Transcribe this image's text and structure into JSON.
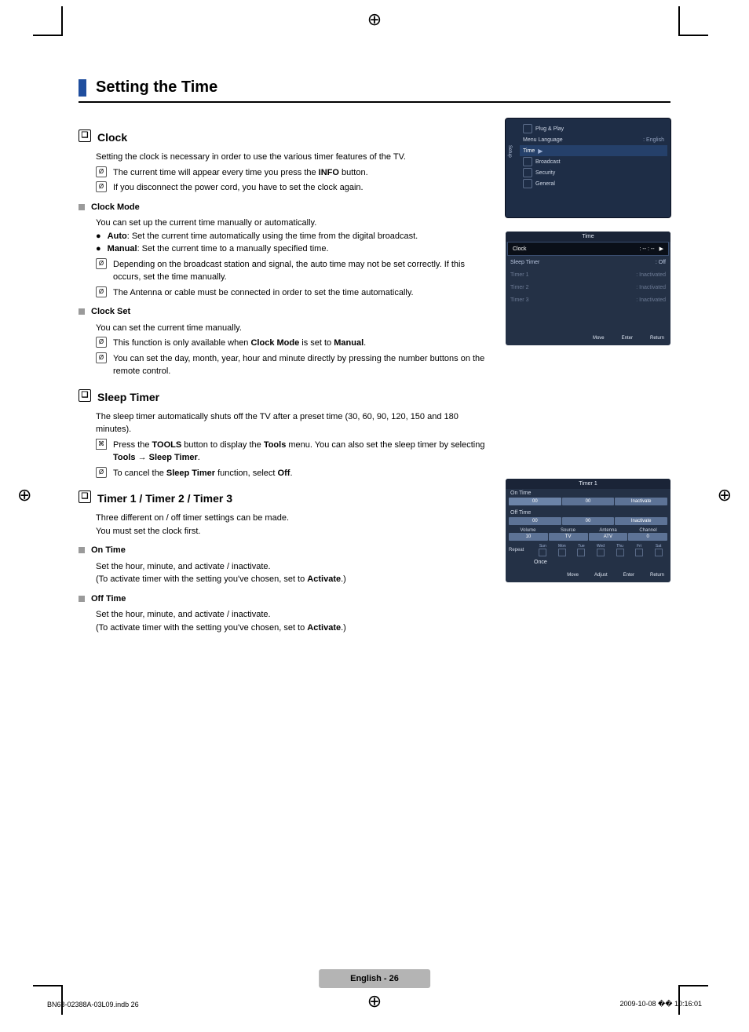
{
  "section_title": "Setting the Time",
  "clock": {
    "title": "Clock",
    "intro": "Setting the clock is necessary in order to use the various timer features of the TV.",
    "note1_a": "The current time will appear every time you press the ",
    "note1_b": "INFO",
    "note1_c": " button.",
    "note2": "If you disconnect the power cord, you have to set the clock again.",
    "mode_title": "Clock Mode",
    "mode_intro": "You can set up the current time manually or automatically.",
    "auto_label": "Auto",
    "auto_text": ": Set the current time automatically using the time from the digital broadcast.",
    "manual_label": "Manual",
    "manual_text": ": Set the current time to a manually specified time.",
    "mode_note1": "Depending on the broadcast station and signal, the auto time may not be set correctly. If this occurs, set the time manually.",
    "mode_note2": "The Antenna or cable must be connected in order to set the time automatically.",
    "set_title": "Clock Set",
    "set_intro": "You can set the current time manually.",
    "set_note1_a": "This function is only available when ",
    "set_note1_b": "Clock Mode",
    "set_note1_c": " is set to ",
    "set_note1_d": "Manual",
    "set_note1_e": ".",
    "set_note2": "You can set the day, month, year, hour and minute directly by pressing the number buttons on the remote control."
  },
  "sleep": {
    "title": "Sleep Timer",
    "intro": "The sleep timer automatically shuts off the TV after a preset time (30, 60, 90, 120, 150 and 180 minutes).",
    "tool_a": "Press the ",
    "tool_b": "TOOLS",
    "tool_c": " button to display the ",
    "tool_d": "Tools",
    "tool_e": " menu. You can also set the sleep timer by selecting ",
    "tool_f": "Tools → Sleep Timer",
    "tool_g": ".",
    "cancel_a": "To cancel the ",
    "cancel_b": "Sleep Timer",
    "cancel_c": " function, select ",
    "cancel_d": "Off",
    "cancel_e": "."
  },
  "timer": {
    "title": "Timer 1 / Timer 2 / Timer 3",
    "intro1": "Three different on / off timer settings can be made.",
    "intro2": "You must set the clock first.",
    "on_title": "On Time",
    "on_l1": "Set the hour, minute, and activate / inactivate.",
    "on_l2_a": "(To activate timer with the setting you've chosen, set to ",
    "on_l2_b": "Activate",
    "on_l2_c": ".)",
    "off_title": "Off Time",
    "off_l1": "Set the hour, minute, and activate / inactivate.",
    "off_l2_a": "(To activate timer with the setting you've chosen, set to ",
    "off_l2_b": "Activate",
    "off_l2_c": ".)"
  },
  "osd_setup": {
    "setup_tag": "Setup",
    "r1": "Plug & Play",
    "r2": "Menu Language",
    "r2v": ": English",
    "r3": "Time",
    "r4": "Broadcast",
    "r5": "Security",
    "r6": "General"
  },
  "osd_time": {
    "title": "Time",
    "clock": "Clock",
    "clock_v": ": -- : --",
    "sleep": "Sleep Timer",
    "sleep_v": ": Off",
    "t1": "Timer 1",
    "t1v": ": Inactivated",
    "t2": "Timer 2",
    "t2v": ": Inactivated",
    "t3": "Timer 3",
    "t3v": ": Inactivated",
    "move": "Move",
    "enter": "Enter",
    "return": "Return"
  },
  "osd_timer1": {
    "title": "Timer 1",
    "on": "On Time",
    "off": "Off Time",
    "seg_on": [
      "00",
      "00",
      "Inactivate"
    ],
    "seg_off": [
      "00",
      "00",
      "Inactivate"
    ],
    "labs": [
      "Volume",
      "Source",
      "Antenna",
      "Channel"
    ],
    "vals": [
      "10",
      "TV",
      "ATV",
      "0"
    ],
    "repeat": "Repeat",
    "once": "Once",
    "days": [
      "Sun",
      "Mon",
      "Tue",
      "Wed",
      "Thu",
      "Fri",
      "Sat"
    ],
    "move": "Move",
    "adjust": "Adjust",
    "enter": "Enter",
    "return": "Return"
  },
  "page_label": "English - 26",
  "footer_left": "BN68-02388A-03L09.indb   26",
  "footer_right": "2009-10-08   �� 10:16:01"
}
